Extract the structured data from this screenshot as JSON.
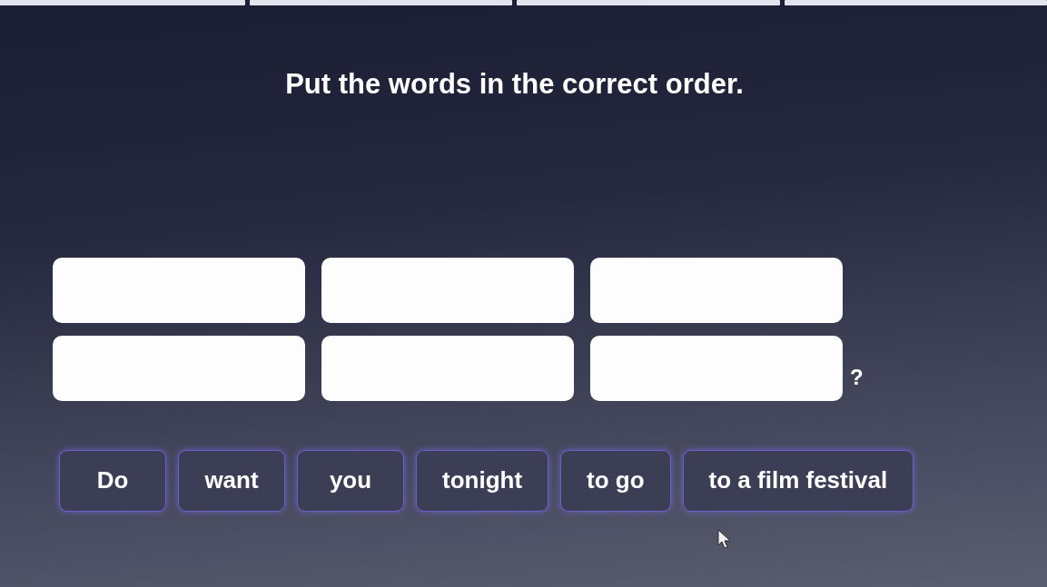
{
  "progress": {
    "segments": [
      {
        "done": true
      },
      {
        "done": true
      },
      {
        "done": true
      },
      {
        "done": true
      }
    ]
  },
  "title": "Put the words in the correct order.",
  "answer": {
    "slots": [
      {
        "filled": false
      },
      {
        "filled": false
      },
      {
        "filled": false
      },
      {
        "filled": false
      },
      {
        "filled": false
      },
      {
        "filled": false
      }
    ],
    "end_mark": "?"
  },
  "words": [
    "Do",
    "want",
    "you",
    "tonight",
    "to go",
    "to a film festival"
  ]
}
